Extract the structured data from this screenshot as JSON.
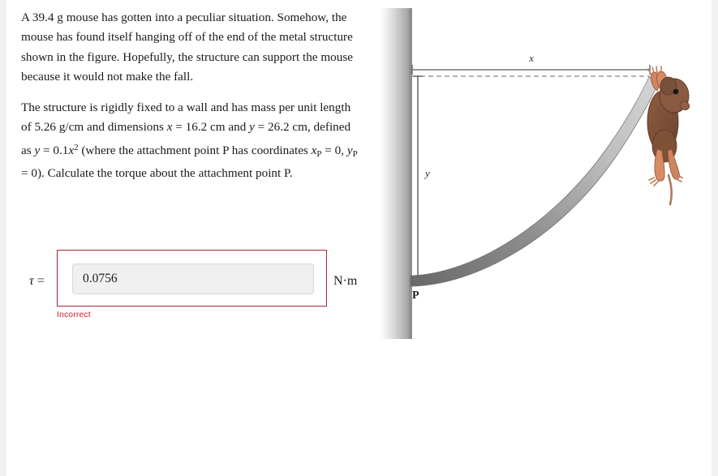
{
  "problem": {
    "paragraph1_parts": {
      "a": "A 39.4 g mouse has gotten into a peculiar situation. Somehow, the mouse has found itself hanging off of the end of the metal structure shown in the figure. Hopefully, the structure can support the mouse because it would not make the fall."
    },
    "paragraph2_parts": {
      "p1": "The structure is rigidly fixed to a wall and has mass per unit length of 5.26 g/cm and dimensions ",
      "var_x": "x",
      "eq1": " = ",
      "val_x": "16.2 cm",
      "and1": " and ",
      "var_y": "y",
      "eq2": " = ",
      "val_y": "26.2 cm",
      "p2": ", defined as ",
      "var_y2": "y",
      "eq3": " = ",
      "formula_coef": "0.1",
      "formula_x": "x",
      "formula_pow": "2",
      "p3": " (where the attachment point P has coordinates ",
      "var_xp": "x",
      "sub_p1": "P",
      "eq4": " = ",
      "val_xp": "0",
      "comma": ", ",
      "var_yp": "y",
      "sub_p2": "P",
      "eq5": " = ",
      "val_yp": "0",
      "p4": "). Calculate the torque about the attachment point P."
    }
  },
  "answer": {
    "tau_symbol": "τ",
    "equals": " =",
    "value": "0.0756",
    "placeholder": "",
    "unit": "N·m",
    "status": "Incorrect",
    "status_color": "#cf2030",
    "border_color": "#a32638"
  },
  "figure": {
    "label_x": "x",
    "label_y": "y",
    "label_p": "P",
    "wall_color_light": "#ffffff",
    "wall_color_dark": "#a8a8a8",
    "beam_color_light": "#d0d0d0",
    "beam_color_dark": "#6e6e6e",
    "mouse_body_color": "#8a5a42",
    "mouse_limb_color": "#d88a63",
    "dimension_line_color": "#5a5a5a"
  },
  "chart_data": {
    "type": "line",
    "title": "",
    "xlabel": "x",
    "ylabel": "y",
    "curve_equation": "y = 0.1x^2",
    "x_range_cm": [
      0,
      16.2
    ],
    "y_range_cm": [
      0,
      26.2
    ],
    "annotations": [
      "P",
      "x",
      "y"
    ],
    "points": [
      {
        "x": 0.0,
        "y": 0.0
      },
      {
        "x": 2.0,
        "y": 0.4
      },
      {
        "x": 4.0,
        "y": 1.6
      },
      {
        "x": 6.0,
        "y": 3.6
      },
      {
        "x": 8.0,
        "y": 6.4
      },
      {
        "x": 10.0,
        "y": 10.0
      },
      {
        "x": 12.0,
        "y": 14.4
      },
      {
        "x": 14.0,
        "y": 19.6
      },
      {
        "x": 16.2,
        "y": 26.2
      }
    ]
  }
}
